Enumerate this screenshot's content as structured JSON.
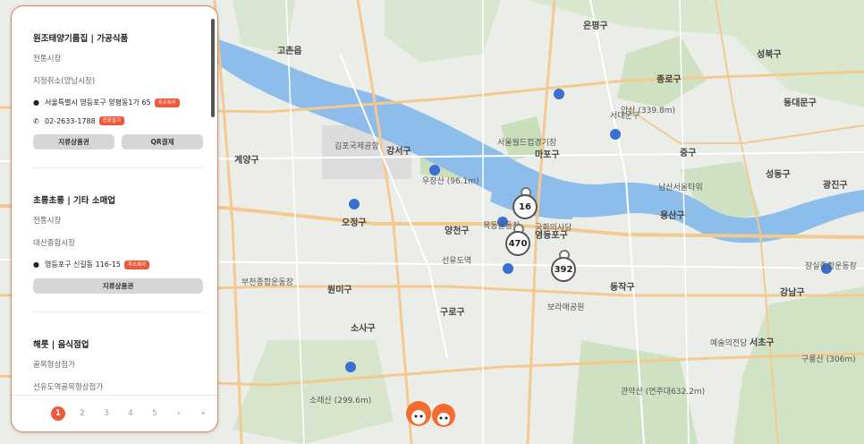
{
  "map": {
    "districts": [
      "고촌읍",
      "계양구",
      "강서구",
      "양천구",
      "오정구",
      "구로구",
      "소사구",
      "원미구",
      "마포구",
      "은평구",
      "종로구",
      "중구",
      "성북구",
      "동대문구",
      "용산구",
      "동작구",
      "서초구",
      "성동구",
      "광진구",
      "강남구",
      "영등포구"
    ],
    "places": [
      "김포국제공항",
      "서울월드컵경기장",
      "우장산 (96.1m)",
      "목동운동장",
      "국회의사당",
      "남산서울타워",
      "안산 (339.8m)",
      "보라매공원",
      "예술의전당",
      "소래산 (299.6m)",
      "구룡산 (306m)",
      "관악산 (연주대632.2m)",
      "장실종합운동장",
      "부천종합운동장",
      "서대문구",
      "선유도역"
    ],
    "markers": [
      {
        "count": "16"
      },
      {
        "count": "470"
      },
      {
        "count": "392"
      }
    ]
  },
  "panel": {
    "cards": [
      {
        "title": "원조태양기름집 | 가공식품",
        "market": "전통시장",
        "status": "지정취소(양남시장)",
        "address": "서울특별시 영등포구 양평동1가 65",
        "address_badge": "주소복사",
        "phone": "02-2633-1788",
        "phone_badge": "전화걸기",
        "buttons": [
          "지류상품권",
          "QR결제"
        ]
      },
      {
        "title": "초롱초롱 | 기타 소매업",
        "market": "전통시장",
        "status": "대산종합시장",
        "address": "영등포구 신길동 116-15",
        "address_badge": "주소복사",
        "buttons": [
          "지류상품권"
        ]
      },
      {
        "title": "해룻 | 음식점업",
        "market": "골목형상점가",
        "status": "선유도역골목형상점가"
      }
    ],
    "pagination": {
      "pages": [
        "1",
        "2",
        "3",
        "4",
        "5"
      ],
      "next": "›",
      "last": "»",
      "current": "1"
    }
  },
  "colors": {
    "accent": "#ef5a3c",
    "river": "#7db3e8",
    "park": "#cfe3c2",
    "road": "#f2c78a"
  }
}
